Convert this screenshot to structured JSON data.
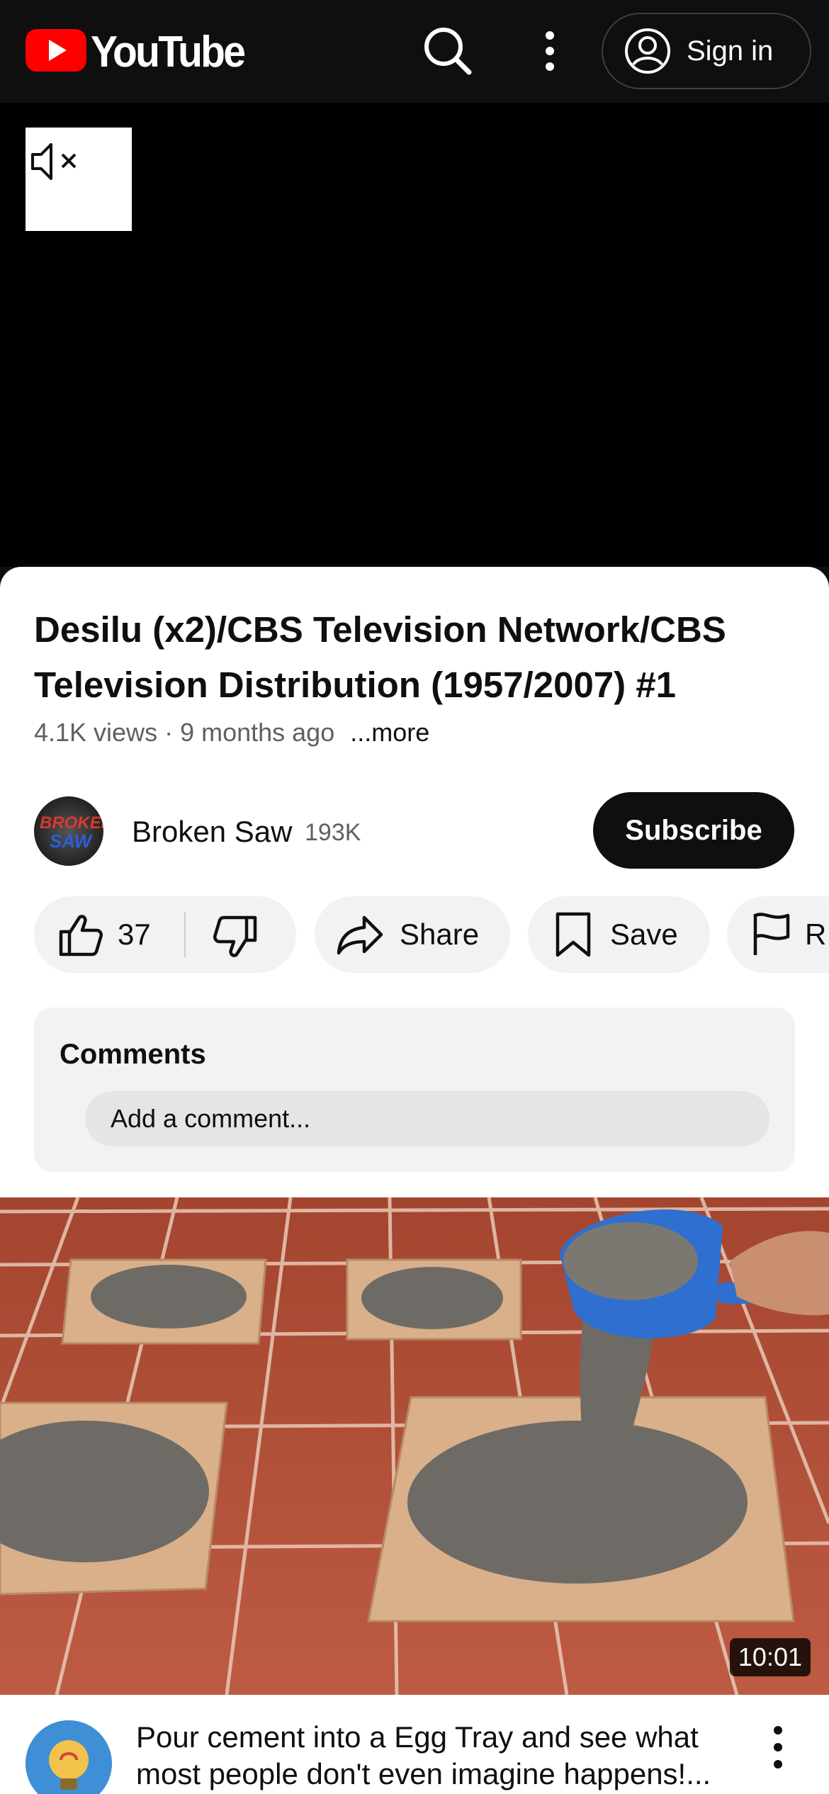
{
  "header": {
    "logo_text": "YouTube",
    "sign_in_label": "Sign in",
    "brand_color": "#ff0000"
  },
  "player": {
    "mute_icon": "speaker-muted-icon"
  },
  "video": {
    "title": "Desilu (x2)/CBS Television Network/CBS Television Distribution (1957/2007) #1",
    "views": "4.1K views",
    "age": "9 months ago",
    "meta": "4.1K views · 9 months ago",
    "more_label": "...more"
  },
  "channel": {
    "name": "Broken Saw",
    "subscribers": "193K",
    "avatar_line1": "BROKEN",
    "avatar_line2": "SAW",
    "subscribe_label": "Subscribe"
  },
  "actions": {
    "like_count": "37",
    "share_label": "Share",
    "save_label": "Save",
    "report_label": "R"
  },
  "comments": {
    "title": "Comments",
    "placeholder": "Add a comment..."
  },
  "next_video": {
    "duration": "10:01",
    "title": "Pour cement into a Egg Tray and see what most people don't even imagine happens!..."
  }
}
